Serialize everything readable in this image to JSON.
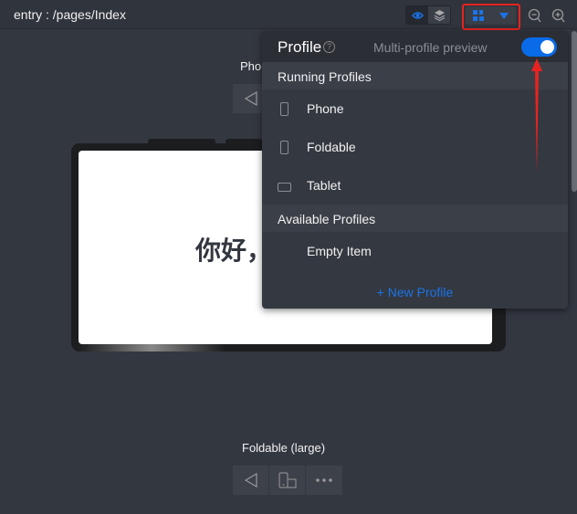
{
  "header": {
    "title": "entry : /pages/Index",
    "icons": [
      "eye-icon",
      "layers-icon",
      "profile-grid-icon",
      "caret-down-icon",
      "zoom-out-icon",
      "zoom-in-icon"
    ]
  },
  "preview": {
    "phone_label": "Phone",
    "tablet_text": "你好，",
    "foldable_label": "Foldable (large)"
  },
  "popup": {
    "title": "Profile",
    "help": "?",
    "multi_label": "Multi-profile preview",
    "multi_enabled": true,
    "running_header": "Running Profiles",
    "running": [
      {
        "label": "Phone",
        "icon": "phone-icon"
      },
      {
        "label": "Foldable",
        "icon": "phone-icon"
      },
      {
        "label": "Tablet",
        "icon": "tablet-icon"
      }
    ],
    "available_header": "Available Profiles",
    "available": [
      {
        "label": "Empty Item"
      }
    ],
    "new_profile": "+ New Profile"
  },
  "colors": {
    "accent": "#0a6be8",
    "annotation": "#e8231f"
  }
}
